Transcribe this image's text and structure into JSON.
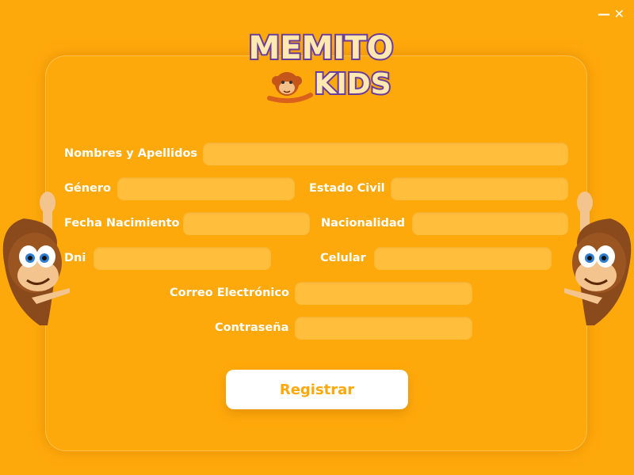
{
  "window": {
    "minimize_symbol": "—",
    "close_symbol": "✕"
  },
  "logo": {
    "line1": "MEMITO",
    "line2": "KIDS",
    "mascot_icon": "monkey-icon"
  },
  "form": {
    "fields": {
      "nombres": {
        "label": "Nombres y Apellidos",
        "value": "",
        "placeholder": ""
      },
      "genero": {
        "label": "Género",
        "value": "",
        "placeholder": ""
      },
      "estado_civil": {
        "label": "Estado Civil",
        "value": "",
        "placeholder": ""
      },
      "fecha_nacimiento": {
        "label": "Fecha Nacimiento",
        "value": "",
        "placeholder": ""
      },
      "nacionalidad": {
        "label": "Nacionalidad",
        "value": "",
        "placeholder": ""
      },
      "dni": {
        "label": "Dni",
        "value": "",
        "placeholder": ""
      },
      "celular": {
        "label": "Celular",
        "value": "",
        "placeholder": ""
      },
      "correo": {
        "label": "Correo Electrónico",
        "value": "",
        "placeholder": ""
      },
      "contrasena": {
        "label": "Contraseña",
        "value": "",
        "placeholder": ""
      }
    },
    "submit_label": "Registrar"
  },
  "colors": {
    "background": "#fea90b",
    "field": "#ffbf3d",
    "label": "#ffffff",
    "button_bg": "#ffffff",
    "button_text": "#fea90b",
    "logo_text": "#7b4bb0",
    "logo_fill": "#ffe9b0"
  },
  "decorations": {
    "left_mascot": "monkey-pointing-icon",
    "right_mascot": "monkey-pointing-icon"
  }
}
